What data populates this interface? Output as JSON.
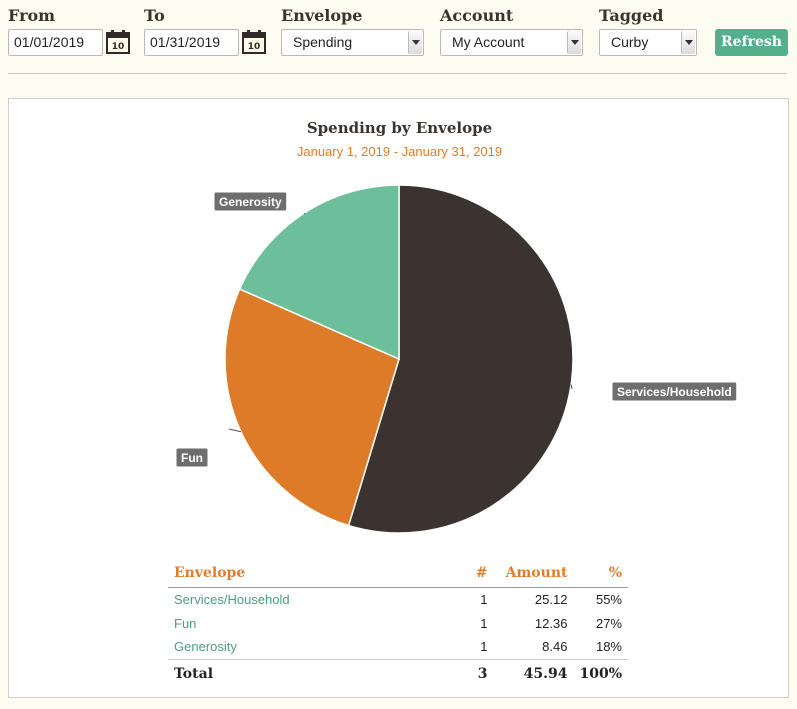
{
  "filters": {
    "from_label": "From",
    "from_value": "01/01/2019",
    "to_label": "To",
    "to_value": "01/31/2019",
    "envelope_label": "Envelope",
    "envelope_value": "Spending",
    "account_label": "Account",
    "account_value": "My Account",
    "tagged_label": "Tagged",
    "tagged_value": "Curby",
    "refresh_label": "Refresh",
    "calendar_day": "10"
  },
  "chart_data": {
    "type": "pie",
    "title": "Spending by Envelope",
    "subtitle": "January 1, 2019 - January 31, 2019",
    "slices": [
      {
        "label": "Services/Household",
        "value": 25.12,
        "color": "#3b3330"
      },
      {
        "label": "Fun",
        "value": 12.36,
        "color": "#de7b28"
      },
      {
        "label": "Generosity",
        "value": 8.46,
        "color": "#6cbf98"
      }
    ]
  },
  "table": {
    "headers": {
      "envelope": "Envelope",
      "count": "#",
      "amount": "Amount",
      "percent": "%"
    },
    "rows": [
      {
        "envelope": "Services/Household",
        "count": "1",
        "amount": "25.12",
        "percent": "55%"
      },
      {
        "envelope": "Fun",
        "count": "1",
        "amount": "12.36",
        "percent": "27%"
      },
      {
        "envelope": "Generosity",
        "count": "1",
        "amount": "8.46",
        "percent": "18%"
      }
    ],
    "total": {
      "label": "Total",
      "count": "3",
      "amount": "45.94",
      "percent": "100%"
    }
  }
}
